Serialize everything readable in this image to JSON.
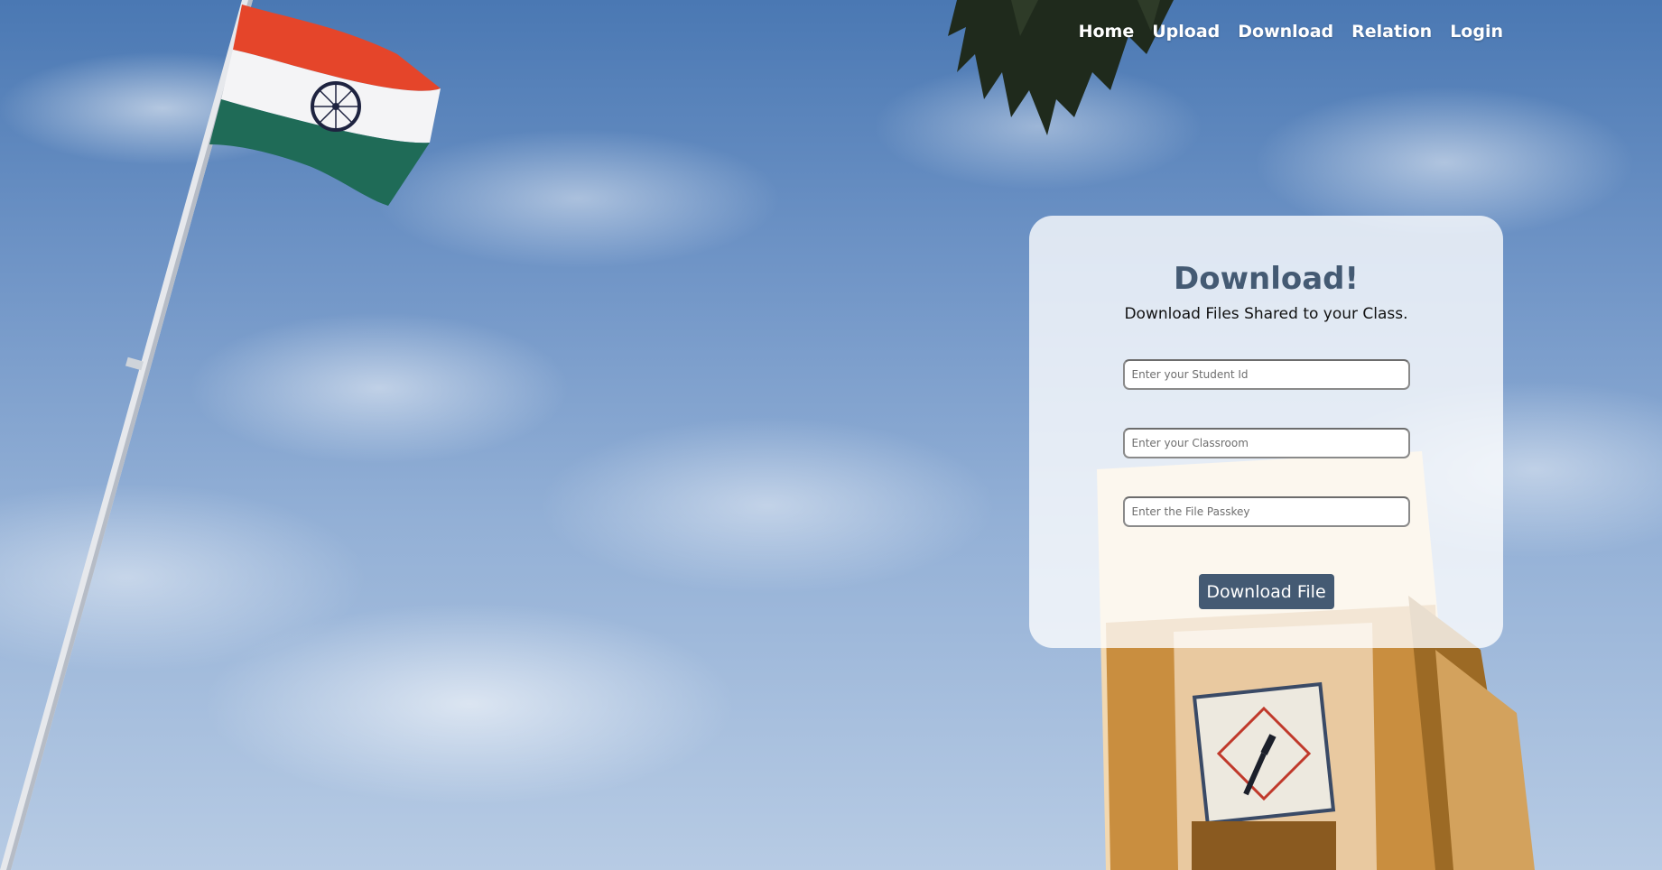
{
  "nav": {
    "items": [
      {
        "label": "Home"
      },
      {
        "label": "Upload"
      },
      {
        "label": "Download"
      },
      {
        "label": "Relation"
      },
      {
        "label": "Login"
      }
    ]
  },
  "form": {
    "title": "Download!",
    "subtitle": "Download Files Shared to your Class.",
    "student_id_placeholder": "Enter your Student Id",
    "classroom_placeholder": "Enter your Classroom",
    "passkey_placeholder": "Enter the File Passkey",
    "submit_label": "Download File"
  },
  "colors": {
    "accent": "#445a73",
    "nav_text": "#ffffff",
    "card_background": "rgba(255,255,255,0.78)"
  }
}
